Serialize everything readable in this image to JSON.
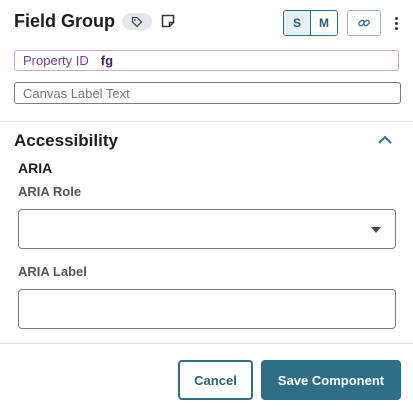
{
  "header": {
    "title": "Field Group",
    "size_options": [
      "S",
      "M"
    ],
    "active_size": "S",
    "icons": [
      "tag-icon",
      "note-icon",
      "link-icon",
      "more-vertical-icon"
    ]
  },
  "property_id": {
    "label": "Property ID",
    "value": "fg"
  },
  "canvas_label": {
    "placeholder": "Canvas Label Text",
    "value": ""
  },
  "accessibility": {
    "title": "Accessibility",
    "group_heading": "ARIA",
    "role_label": "ARIA Role",
    "role_value": "",
    "label_label": "ARIA Label",
    "label_value": ""
  },
  "footer": {
    "cancel_label": "Cancel",
    "save_label": "Save Component"
  },
  "colors": {
    "accent": "#2e6f86",
    "property_border": "#c9a6d8",
    "property_text": "#7a3c9a"
  }
}
